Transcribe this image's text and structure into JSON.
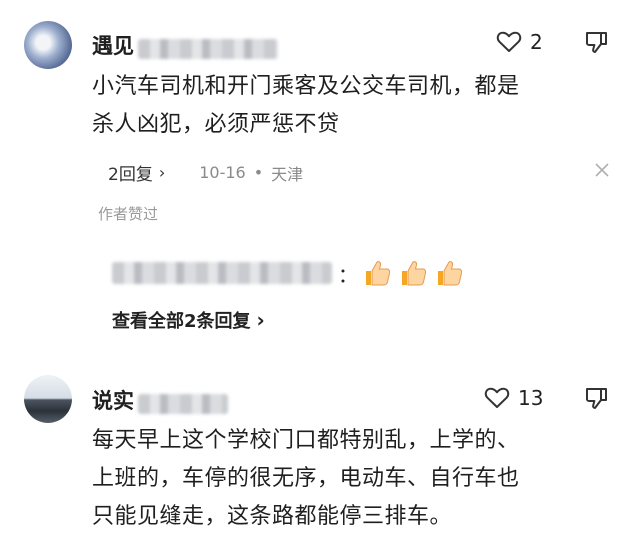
{
  "comments": [
    {
      "username": "遇见",
      "like_count": "2",
      "text_line1": "小汽车司机和开门乘客及公交车司机，都是",
      "text_line2": "杀人凶犯，必须严惩不贷",
      "reply_label": "2回复",
      "date": "10-16",
      "location": "天津",
      "author_liked": "作者赞过",
      "reply_preview_suffix": "：",
      "view_all_replies": "查看全部2条回复"
    },
    {
      "username": "说实",
      "like_count": "13",
      "text_line1": "每天早上这个学校门口都特别乱，上学的、",
      "text_line2": "上班的，车停的很无序，电动车、自行车也",
      "text_line3": "只能见缝走，这条路都能停三排车。"
    }
  ],
  "icons": {
    "like": "heart-outline-icon",
    "dislike": "thumbs-down-outline-icon",
    "dismiss": "close-icon",
    "reaction": "thumbs-up-emoji"
  },
  "colors": {
    "text": "#1f1f1f",
    "meta": "#8a8a8a",
    "thumb": "#f4a261"
  }
}
